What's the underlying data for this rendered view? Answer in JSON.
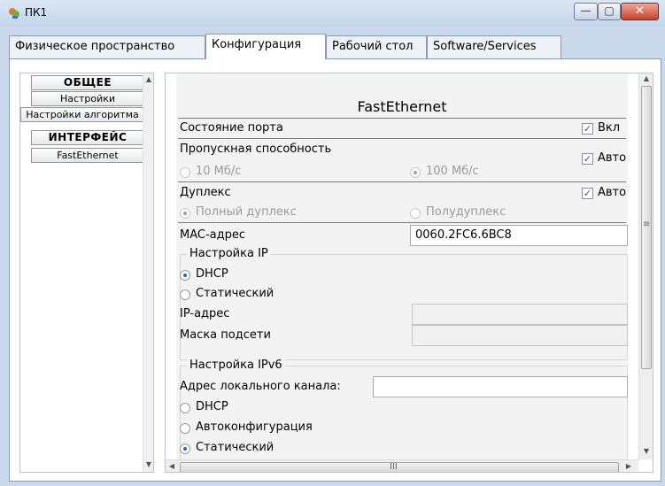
{
  "window": {
    "title": "ПК1",
    "minimize_glyph": "—",
    "maximize_glyph": "▢",
    "close_glyph": "✕"
  },
  "tabs": [
    {
      "label": "Физическое пространство"
    },
    {
      "label": "Конфигурация"
    },
    {
      "label": "Рабочий стол"
    },
    {
      "label": "Software/Services"
    }
  ],
  "sidebar": {
    "general_header": "ОБЩЕЕ",
    "settings": "Настройки",
    "algorithm_settings": "Настройки алгоритма",
    "interface_header": "ИНТЕРФЕЙС",
    "fastethernet": "FastEthernet"
  },
  "panel": {
    "title": "FastEthernet",
    "port_status": {
      "label": "Состояние порта",
      "checkbox_label": "Вкл",
      "checked": true
    },
    "bandwidth": {
      "label": "Пропускная способность",
      "checkbox_label": "Авто",
      "checked": true
    },
    "speed_10": "10 Мб/с",
    "speed_100": "100 Мб/с",
    "duplex": {
      "label": "Дуплекс",
      "checkbox_label": "Авто",
      "checked": true
    },
    "full_duplex": "Полный дуплекс",
    "half_duplex": "Полудуплекс",
    "mac": {
      "label": "MAC-адрес",
      "value": "0060.2FC6.6BC8"
    },
    "ip_config": {
      "legend": "Настройка IP",
      "dhcp": "DHCP",
      "static": "Статический",
      "ip_label": "IP-адрес",
      "ip_value": "",
      "mask_label": "Маска подсети",
      "mask_value": ""
    },
    "ipv6_config": {
      "legend": "Настройка IPv6",
      "link_local_label": "Адрес локального канала:",
      "link_local_value": "",
      "dhcp": "DHCP",
      "autoconfig": "Автоконфигурация",
      "static": "Статический"
    }
  },
  "scrollbars": {
    "hscroll_grip": "III",
    "vscroll_grip": "≡"
  },
  "colors": {
    "titlebar": "#c9d8ea",
    "close_button": "#c7432d",
    "radio_selected": "#2f5fbf"
  }
}
